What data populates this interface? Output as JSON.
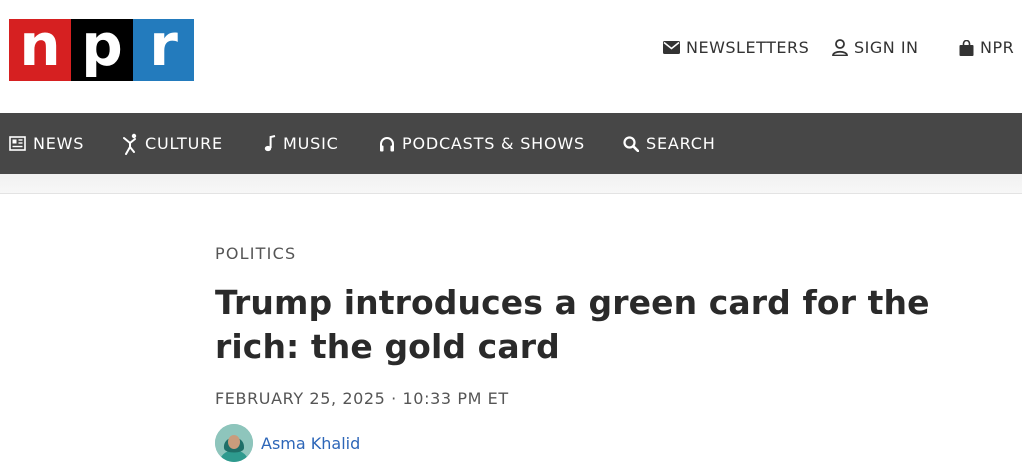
{
  "brand": {
    "letters": [
      "n",
      "p",
      "r"
    ],
    "colors": {
      "n": "#d62021",
      "p": "#000000",
      "r": "#237bbd"
    }
  },
  "utility_nav": {
    "newsletters": {
      "label": "NEWSLETTERS",
      "icon": "envelope-icon"
    },
    "sign_in": {
      "label": "SIGN IN",
      "icon": "user-icon"
    },
    "shop": {
      "label": "NPR",
      "icon": "shopping-bag-icon"
    }
  },
  "main_nav": [
    {
      "label": "NEWS",
      "icon": "newspaper-icon"
    },
    {
      "label": "CULTURE",
      "icon": "dancer-icon"
    },
    {
      "label": "MUSIC",
      "icon": "music-note-icon"
    },
    {
      "label": "PODCASTS & SHOWS",
      "icon": "headphones-icon"
    },
    {
      "label": "SEARCH",
      "icon": "search-icon"
    }
  ],
  "colors": {
    "nav_background": "#474747",
    "byline_link": "#2d66b8"
  },
  "article": {
    "slug": "POLITICS",
    "headline": "Trump introduces a green card for the rich: the gold card",
    "dateline": "FEBRUARY 25, 2025 · 10:33 PM ET",
    "author": "Asma Khalid"
  }
}
